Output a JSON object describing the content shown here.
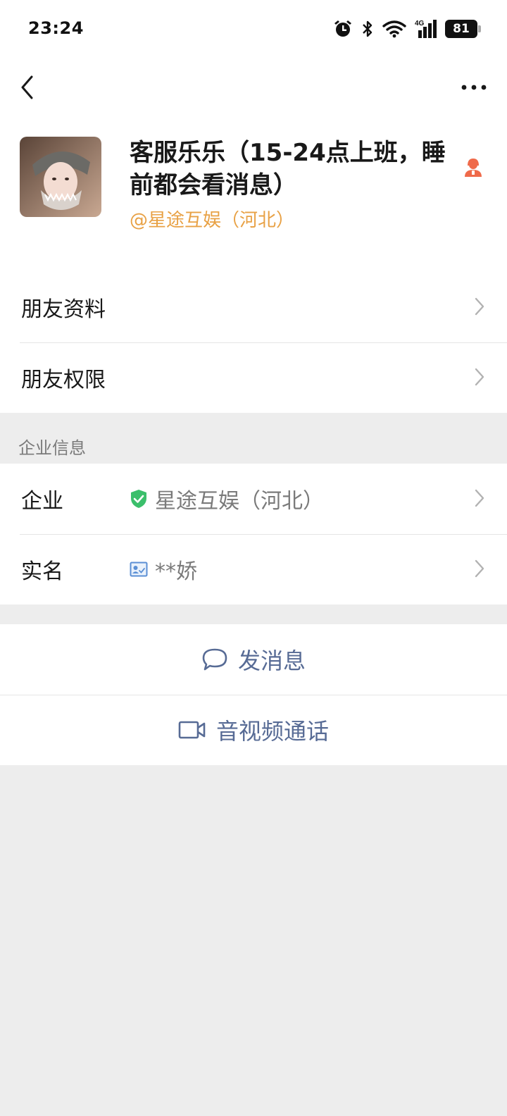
{
  "status_bar": {
    "time": "23:24",
    "network": "4G",
    "battery": "81"
  },
  "nav": {
    "back_icon": "chevron-left-icon",
    "more_icon": "more-icon"
  },
  "profile": {
    "name": "客服乐乐（15-24点上班，睡前都会看消息）",
    "corp_tag": "@星途互娱（河北）",
    "role_icon": "customer-service-icon"
  },
  "menu": [
    {
      "label": "朋友资料"
    },
    {
      "label": "朋友权限"
    }
  ],
  "enterprise": {
    "section_title": "企业信息",
    "company_label": "企业",
    "company_value": "星途互娱（河北）",
    "realname_label": "实名",
    "realname_value": "**娇"
  },
  "actions": {
    "message_label": "发消息",
    "call_label": "音视频通话"
  },
  "colors": {
    "link": "#576b95",
    "corp": "#e8a145",
    "verified": "#3bbf6b",
    "role": "#ef6a4a"
  }
}
